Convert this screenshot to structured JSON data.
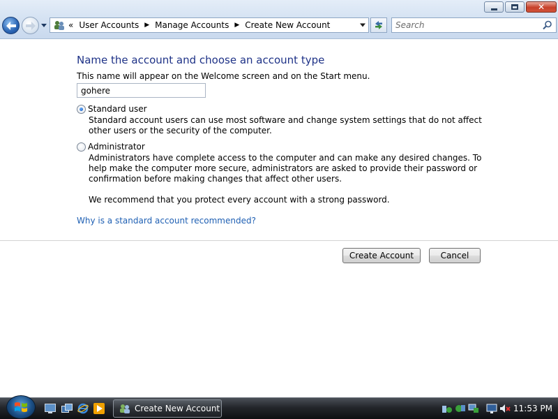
{
  "window": {
    "controls": {
      "minimize": "minimize",
      "maximize": "maximize",
      "close": "close"
    }
  },
  "nav": {
    "address": {
      "chevron": "«",
      "crumbs": [
        "User Accounts",
        "Manage Accounts",
        "Create New Account"
      ]
    },
    "search": {
      "placeholder": "Search"
    }
  },
  "content": {
    "heading": "Name the account and choose an account type",
    "subtext": "This name will appear on the Welcome screen and on the Start menu.",
    "account_name_value": "gohere",
    "options": [
      {
        "label": "Standard user",
        "selected": true,
        "description": "Standard account users can use most software and change system settings that do not affect other users or the security of the computer."
      },
      {
        "label": "Administrator",
        "selected": false,
        "description": "Administrators have complete access to the computer and can make any desired changes. To help make the computer more secure, administrators are asked to provide their password or confirmation before making changes that affect other users.",
        "note": "We recommend that you protect every account with a strong password."
      }
    ],
    "help_link": "Why is a standard account recommended?",
    "buttons": {
      "create": "Create Account",
      "cancel": "Cancel"
    }
  },
  "taskbar": {
    "task_button_label": "Create New Account",
    "clock": "11:53 PM"
  },
  "colors": {
    "heading": "#1e3287",
    "link": "#1e5fb3",
    "taskbar": "#1d2024"
  },
  "icons": [
    "back-arrow-icon",
    "forward-arrow-icon",
    "user-accounts-icon",
    "refresh-icon",
    "search-icon",
    "windows-logo-icon",
    "show-desktop-icon",
    "switch-windows-icon",
    "internet-explorer-icon",
    "media-player-icon",
    "network-icon",
    "volume-muted-icon"
  ]
}
